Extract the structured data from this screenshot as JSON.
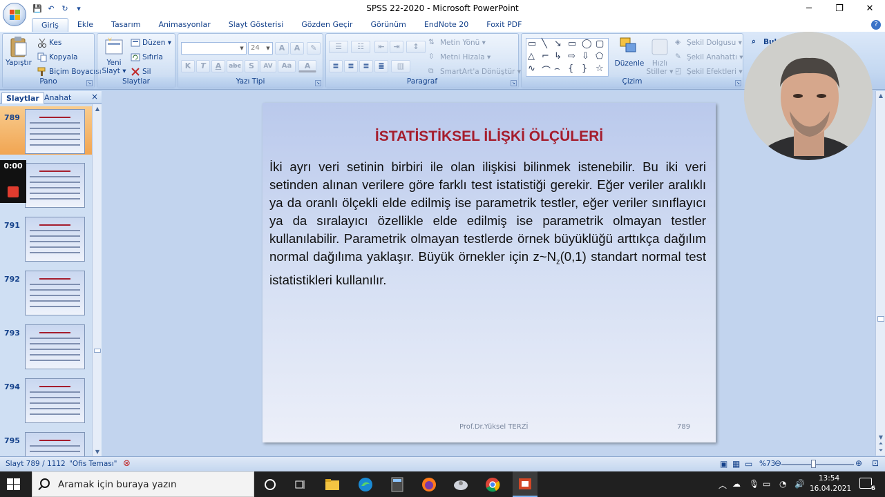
{
  "window": {
    "title": "SPSS 22-2020 - Microsoft PowerPoint",
    "minimize": "─",
    "restore": "❐",
    "close": "✕"
  },
  "qat": {
    "save": "💾",
    "undo": "↶",
    "redo": "↻",
    "more": "▾"
  },
  "ribbon_tabs": [
    "Giriş",
    "Ekle",
    "Tasarım",
    "Animasyonlar",
    "Slayt Gösterisi",
    "Gözden Geçir",
    "Görünüm",
    "EndNote 20",
    "Foxit PDF"
  ],
  "help": "?",
  "groups": {
    "pano": {
      "label": "Pano",
      "paste": "Yapıştır",
      "cut": "Kes",
      "copy": "Kopyala",
      "format_painter": "Biçim Boyacısı"
    },
    "slaytlar": {
      "label": "Slaytlar",
      "new_slide_1": "Yeni",
      "new_slide_2": "Slayt ▾",
      "layout": "Düzen ▾",
      "reset": "Sıfırla",
      "delete": "Sil"
    },
    "yazi_tipi": {
      "label": "Yazı Tipi",
      "font_name": "",
      "font_size": "24",
      "bold": "K",
      "italic": "T",
      "underline": "A",
      "strike": "abc",
      "shadow": "S",
      "spacing": "AV",
      "case": "Aa",
      "color": "A"
    },
    "paragraf": {
      "label": "Paragraf",
      "text_direction": "Metin Yönü ▾",
      "align_text": "Metni Hizala ▾",
      "smartart": "SmartArt'a Dönüştür ▾"
    },
    "cizim": {
      "label": "Çizim",
      "arrange": "Düzenle",
      "quick_styles_1": "Hızlı",
      "quick_styles_2": "Stiller ▾",
      "fill": "Şekil Dolgusu ▾",
      "outline": "Şekil Anahattı ▾",
      "effects": "Şekil Efektleri ▾",
      "extra": "Bul"
    }
  },
  "pane": {
    "tab_slides": "Slaytlar",
    "tab_outline": "Anahat",
    "close": "×"
  },
  "thumbnails": [
    {
      "num": "789"
    },
    {
      "num": ""
    },
    {
      "num": "791"
    },
    {
      "num": "792"
    },
    {
      "num": "793"
    },
    {
      "num": "794"
    },
    {
      "num": "795"
    }
  ],
  "recording": {
    "time": "0:00"
  },
  "slide": {
    "title": "İSTATİSTİKSEL İLİŞKİ ÖLÇÜLERİ",
    "body_pre": "İki ayrı veri setinin birbiri ile olan ilişkisi bilinmek istenebilir. Bu iki veri setinden alınan verilere göre farklı test istatistiği gerekir. Eğer veriler aralıklı ya da oranlı ölçekli elde edilmiş ise parametrik testler, eğer veriler sınıflayıcı ya da sıralayıcı özellikle elde edilmiş ise parametrik olmayan testler kullanılabilir. Parametrik olmayan testlerde örnek büyüklüğü arttıkça dağılım normal dağılıma yaklaşır. Büyük örnekler için z~N",
    "body_sub": "z",
    "body_post": "(0,1) standart normal test istatistikleri kullanılır.",
    "footer": "Prof.Dr.Yüksel TERZİ",
    "number": "789"
  },
  "status": {
    "slide_count": "Slayt 789 / 1112",
    "theme": "\"Ofis Teması\"",
    "zoom": "%73"
  },
  "taskbar": {
    "search_placeholder": "Aramak için buraya yazın",
    "time": "13:54",
    "date": "16.04.2021",
    "notifications": "6"
  },
  "colors": {
    "title_red": "#a51d2d",
    "ribbon_blue": "#15428b",
    "selected_thumb": "#f1a552"
  }
}
